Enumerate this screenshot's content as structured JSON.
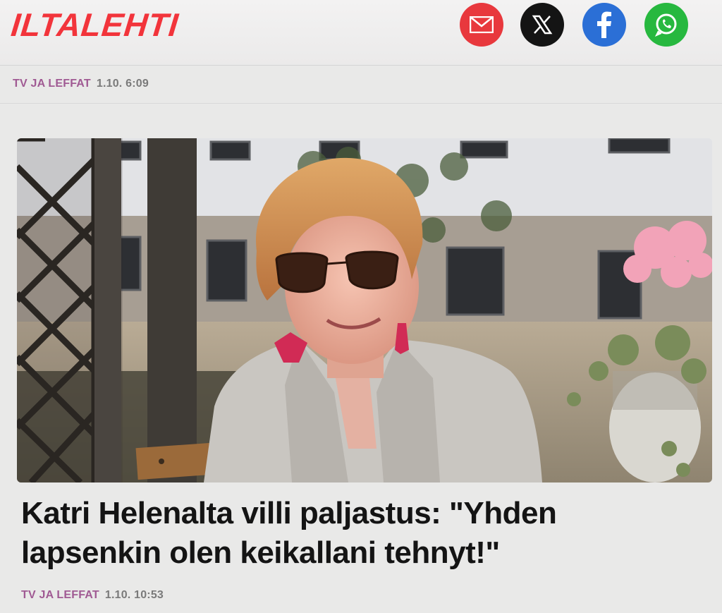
{
  "header": {
    "logo_text": "ILTALEHTI",
    "share": [
      {
        "name": "email",
        "icon": "envelope-icon",
        "color": "#e8383d"
      },
      {
        "name": "x",
        "icon": "x-logo-icon",
        "color": "#141414"
      },
      {
        "name": "facebook",
        "icon": "facebook-icon",
        "color": "#2b6fd6"
      },
      {
        "name": "whatsapp",
        "icon": "whatsapp-icon",
        "color": "#27b83f"
      }
    ]
  },
  "top_article": {
    "category": "TV JA LEFFAT",
    "time": "1.10. 6:09"
  },
  "article": {
    "headline": "Katri Helenalta villi paljastus: \"Yhden lapsenkin olen keikallani tehnyt!\"",
    "category": "TV JA LEFFAT",
    "time": "1.10. 10:53"
  },
  "colors": {
    "brand": "#f2343b",
    "category": "#a05a93"
  }
}
